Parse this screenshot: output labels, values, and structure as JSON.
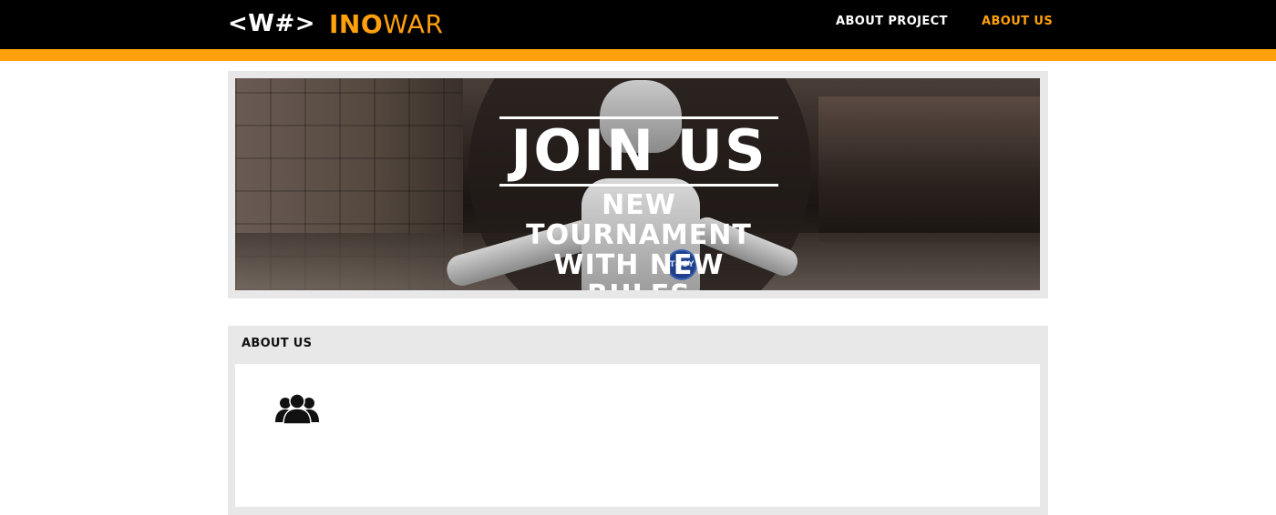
{
  "header": {
    "logo_mark": "<W#>",
    "brand_bold": "INO",
    "brand_light": "WAR",
    "nav": {
      "about_project": "ABOUT PROJECT",
      "about_us": "ABOUT US"
    },
    "accent_color": "#ffa00c"
  },
  "banner": {
    "headline": "JOIN US",
    "subline_1": "NEW TOURNAMENT",
    "subline_2": "WITH NEW RULES",
    "badge_text": "T&SY"
  },
  "about": {
    "title": "ABOUT US",
    "icon": "group-icon"
  }
}
